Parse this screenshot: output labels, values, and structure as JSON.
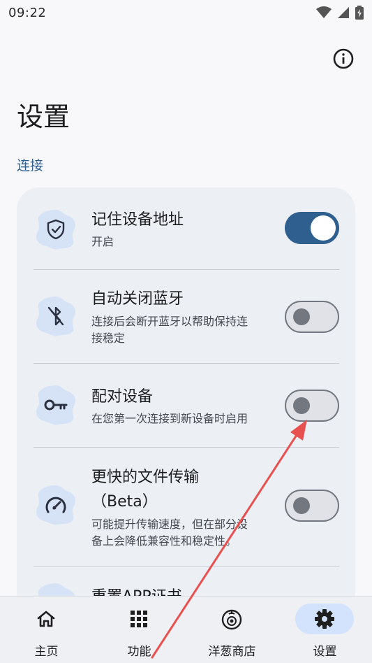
{
  "status_bar": {
    "time": "09:22",
    "wifi_icon": "wifi-icon",
    "signal_icon": "signal-icon",
    "battery_icon": "battery-charging-icon"
  },
  "header": {
    "title": "设置",
    "info_icon": "info-icon"
  },
  "section": {
    "label": "连接"
  },
  "settings": [
    {
      "title": "记住设备地址",
      "subtitle": "开启",
      "icon": "shield-check-icon",
      "enabled": true
    },
    {
      "title": "自动关闭蓝牙",
      "subtitle_line1": "连接后会断开蓝牙以帮助保持连",
      "subtitle_line2": "接稳定",
      "icon": "bluetooth-off-icon",
      "enabled": false
    },
    {
      "title": "配对设备",
      "subtitle": "在您第一次连接到新设备时启用",
      "icon": "key-icon",
      "enabled": false
    },
    {
      "title_line1": "更快的文件传输",
      "title_line2": "（Beta）",
      "subtitle_line1": "可能提升传输速度，但在部分设",
      "subtitle_line2": "备上会降低兼容性和稳定性。",
      "icon": "speedometer-icon",
      "enabled": false
    },
    {
      "title": "重置APP证书",
      "icon": "reset-icon"
    }
  ],
  "bottom_nav": [
    {
      "label": "主页",
      "icon": "home-icon",
      "active": false
    },
    {
      "label": "功能",
      "icon": "grid-icon",
      "active": false
    },
    {
      "label": "洋葱商店",
      "icon": "onion-store-icon",
      "active": false
    },
    {
      "label": "设置",
      "icon": "gear-icon",
      "active": true
    }
  ],
  "colors": {
    "accent": "#2f5f8f",
    "annotation_arrow": "#e8514f",
    "icon_blob": "#d6e3f7"
  }
}
